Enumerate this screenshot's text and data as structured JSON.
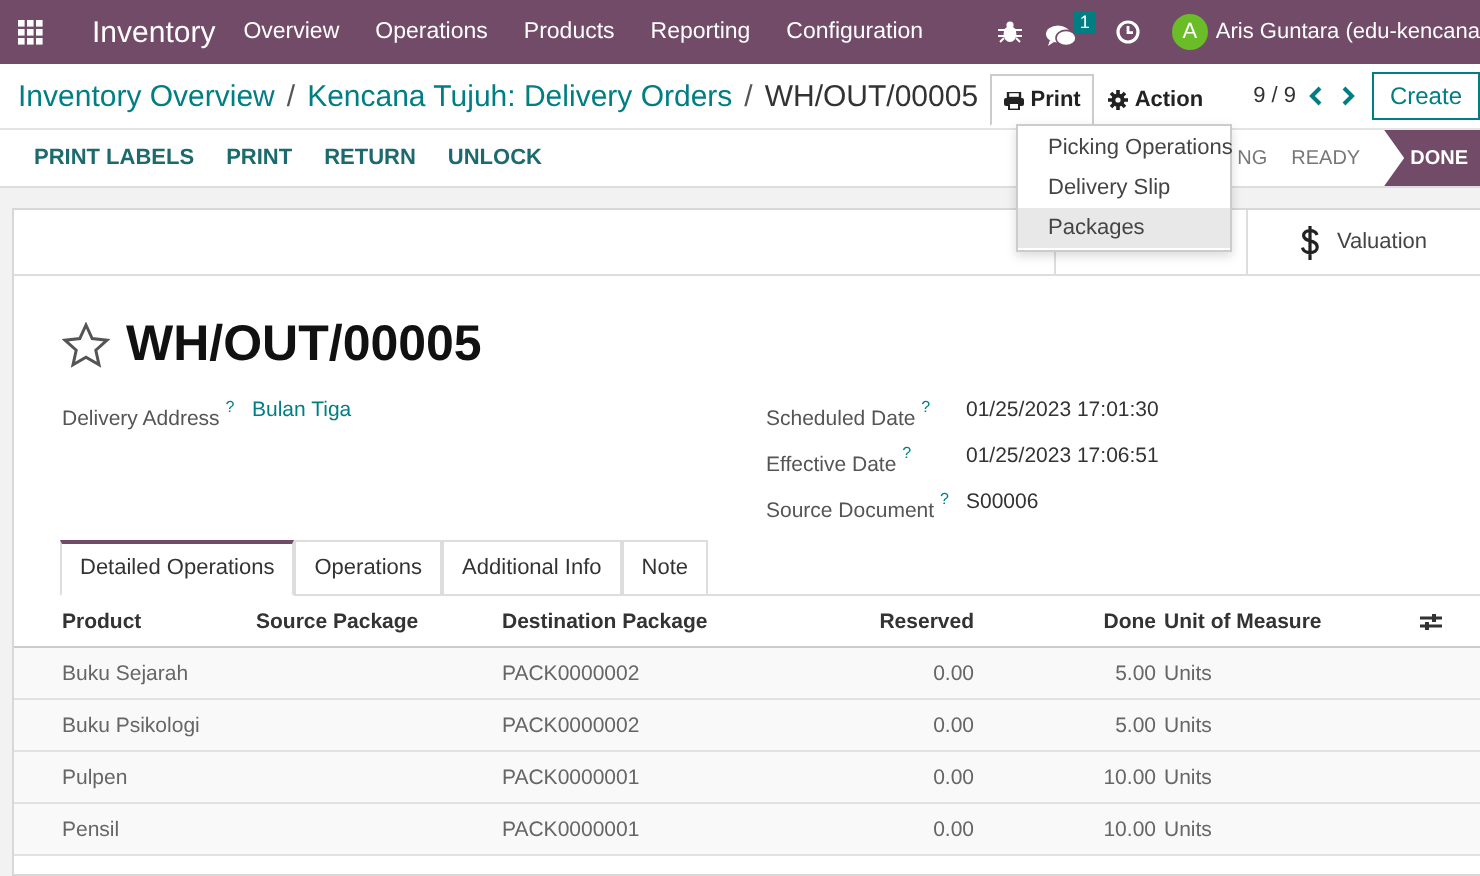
{
  "navbar": {
    "app": "Inventory",
    "menu": [
      "Overview",
      "Operations",
      "Products",
      "Reporting",
      "Configuration"
    ],
    "messages_badge": "1",
    "user": {
      "initial": "A",
      "name": "Aris Guntara (edu-kencana"
    }
  },
  "breadcrumbs": {
    "items": [
      "Inventory Overview",
      "Kencana Tujuh: Delivery Orders",
      "WH/OUT/00005"
    ],
    "separator": "/"
  },
  "toolbar": {
    "print": "Print",
    "action": "Action",
    "pager": "9 / 9",
    "create": "Create"
  },
  "print_menu": [
    {
      "label": "Picking Operations",
      "selected": false
    },
    {
      "label": "Delivery Slip",
      "selected": false
    },
    {
      "label": "Packages",
      "selected": true
    }
  ],
  "buttons": [
    "PRINT LABELS",
    "PRINT",
    "RETURN",
    "UNLOCK"
  ],
  "status": [
    {
      "label": "NG",
      "selected": false
    },
    {
      "label": "READY",
      "selected": false
    },
    {
      "label": "DONE",
      "selected": true
    }
  ],
  "smart_buttons": [
    {
      "label": "Valuation"
    }
  ],
  "record": {
    "starred": false,
    "name": "WH/OUT/00005"
  },
  "fields_left": [
    {
      "label": "Delivery Address",
      "help": "?",
      "value": "Bulan Tiga"
    }
  ],
  "fields_right": [
    {
      "label": "Scheduled Date",
      "help": "?",
      "value": "01/25/2023 17:01:30"
    },
    {
      "label": "Effective Date",
      "help": "?",
      "value": "01/25/2023 17:06:51"
    },
    {
      "label": "Source Document",
      "help": "?",
      "value": "S00006"
    }
  ],
  "tabs": [
    {
      "label": "Detailed Operations",
      "selected": true
    },
    {
      "label": "Operations",
      "selected": false
    },
    {
      "label": "Additional Info",
      "selected": false
    },
    {
      "label": "Note",
      "selected": false
    }
  ],
  "table": {
    "columns": [
      "Product",
      "Source Package",
      "Destination Package",
      "Reserved",
      "Done",
      "Unit of Measure"
    ],
    "rows": [
      [
        "Buku Sejarah",
        "",
        "PACK0000002",
        "0.00",
        "5.00",
        "Units"
      ],
      [
        "Buku Psikologi",
        "",
        "PACK0000002",
        "0.00",
        "5.00",
        "Units"
      ],
      [
        "Pulpen",
        "",
        "PACK0000001",
        "0.00",
        "10.00",
        "Units"
      ],
      [
        "Pensil",
        "",
        "PACK0000001",
        "0.00",
        "10.00",
        "Units"
      ]
    ]
  }
}
